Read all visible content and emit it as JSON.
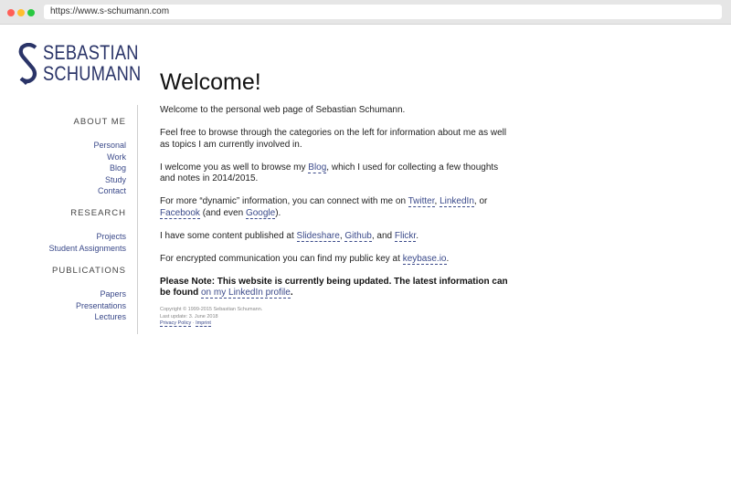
{
  "browser": {
    "url": "https://www.s-schumann.com"
  },
  "logo": {
    "line1": "SEBASTIAN",
    "line2": "SCHUMANN",
    "color": "#2a3468"
  },
  "nav": {
    "about": {
      "heading": "ABOUT ME",
      "items": [
        "Personal",
        "Work",
        "Blog",
        "Study",
        "Contact"
      ]
    },
    "research": {
      "heading": "RESEARCH",
      "items": [
        "Projects",
        "Student Assignments"
      ]
    },
    "publications": {
      "heading": "PUBLICATIONS",
      "items": [
        "Papers",
        "Presentations",
        "Lectures"
      ]
    }
  },
  "main": {
    "title": "Welcome!",
    "p1": "Welcome to the personal web page of Sebastian Schumann.",
    "p2": "Feel free to browse through the categories on the left for information about me as well as topics I am currently involved in.",
    "p3_a": "I welcome you as well to browse my ",
    "p3_link": "Blog",
    "p3_b": ", which I used for collecting a few thoughts and notes in 2014/2015.",
    "p4_a": "For more “dynamic” information, you can connect with me on ",
    "p4_l1": "Twitter",
    "p4_s1": ", ",
    "p4_l2": "LinkedIn",
    "p4_s2": ", or ",
    "p4_l3": "Facebook",
    "p4_s3": " (and even ",
    "p4_l4": "Google",
    "p4_s4": ").",
    "p5_a": "I have some content published at ",
    "p5_l1": "Slideshare",
    "p5_s1": ", ",
    "p5_l2": "Github",
    "p5_s2": ", and ",
    "p5_l3": "Flickr",
    "p5_s3": ".",
    "p6_a": "For encrypted communication you can find my public key at ",
    "p6_link": "keybase.io",
    "p6_b": ".",
    "note_a": "Please Note: This website is currently being updated. The latest information can be found ",
    "note_link": "on my LinkedIn profile",
    "note_b": ".",
    "copyright": "Copyright © 1999-2015 Sebastian Schumann.",
    "last_update": "Last update: 3. June 2018",
    "privacy": "Privacy Policy",
    "sep": " · ",
    "imprint": "Imprint"
  },
  "colors": {
    "link": "#3b4a8a",
    "text": "#222222"
  }
}
